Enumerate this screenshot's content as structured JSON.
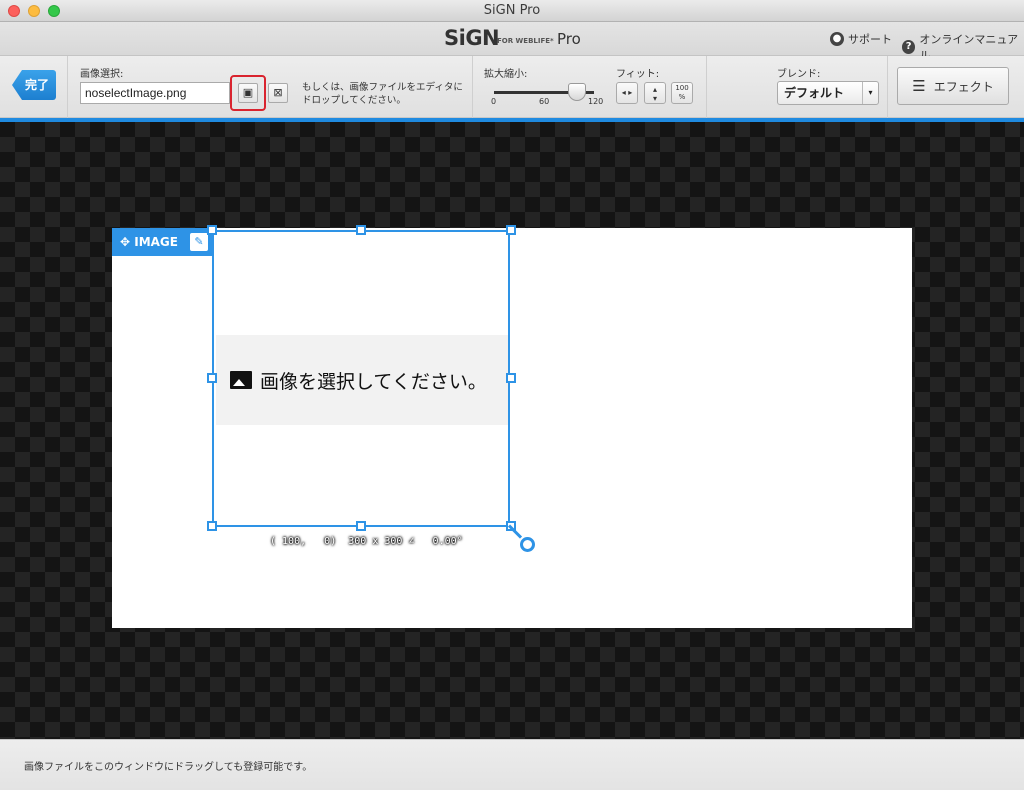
{
  "window": {
    "title": "SiGN Pro"
  },
  "brand": {
    "logo": "SiGN",
    "sub": "FOR WEBLIFE*",
    "edition": "Pro"
  },
  "links": {
    "support": "サポート",
    "manual": "オンラインマニュアル"
  },
  "toolbar": {
    "done_label": "完了",
    "image_select_label": "画像選択:",
    "file_name": "noselectImage.png",
    "drop_hint": "もしくは、画像ファイルをエディタにドロップしてください。",
    "zoom_label": "拡大縮小:",
    "zoom_ticks": [
      "0",
      "60",
      "120"
    ],
    "zoom_value": 120,
    "fit_label": "フィット:",
    "fit_100": "100",
    "fit_percent": "%",
    "blend_label": "ブレンド:",
    "blend_value": "デフォルト",
    "effect_label": "エフェクト"
  },
  "layer": {
    "tag_label": "IMAGE",
    "placeholder_text": "画像を選択してください。",
    "coords": "( 100,   0)  300 x 300 ∠   0.00°"
  },
  "status": {
    "text": "画像ファイルをこのウィンドウにドラッグしても登録可能です。"
  },
  "colors": {
    "accent": "#2e93e6",
    "highlight": "#d9232e"
  }
}
